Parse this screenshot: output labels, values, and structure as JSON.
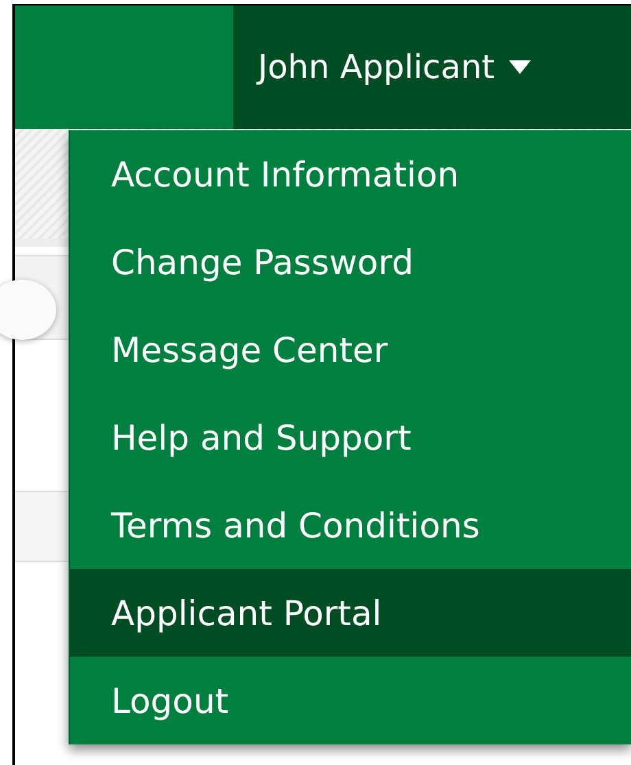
{
  "user_menu": {
    "label": "John Applicant",
    "expanded": true,
    "items": [
      {
        "label": "Account Information",
        "selected": false
      },
      {
        "label": "Change Password",
        "selected": false
      },
      {
        "label": "Message Center",
        "selected": false
      },
      {
        "label": "Help and Support",
        "selected": false
      },
      {
        "label": "Terms and Conditions",
        "selected": false
      },
      {
        "label": "Applicant Portal",
        "selected": true
      },
      {
        "label": "Logout",
        "selected": false
      }
    ]
  }
}
